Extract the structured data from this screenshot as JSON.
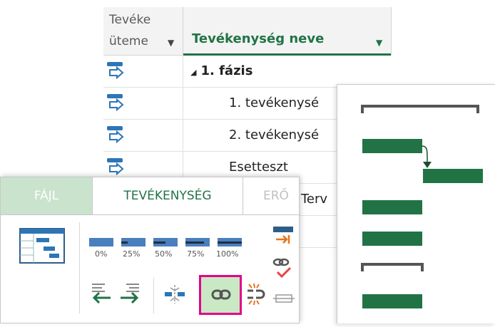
{
  "table": {
    "col_mode_line1": "Tevéke",
    "col_mode_line2": "üteme",
    "col_name": "Tevékenység neve",
    "rows": [
      {
        "name": "1. fázis"
      },
      {
        "name": "1. tevékenysé"
      },
      {
        "name": "2. tevékenysé"
      },
      {
        "name": "Esetteszt"
      },
      {
        "name": "Terv"
      }
    ]
  },
  "ribbon": {
    "tabs": [
      {
        "label": "FÁJL"
      },
      {
        "label": "TEVÉKENYSÉG"
      },
      {
        "label": "ERŐ"
      }
    ],
    "progress": [
      "0%",
      "25%",
      "50%",
      "75%",
      "100%"
    ]
  },
  "colors": {
    "accent": "#217346",
    "bar": "#217346",
    "tab_file": "#c9e3cc",
    "highlight": "#e3008c",
    "link_bg": "#c9e8c4"
  },
  "icons": [
    "task-mode-icon",
    "gantt-chart-icon",
    "outdent-icon",
    "indent-icon",
    "split-task-icon",
    "link-tasks-icon",
    "unlink-tasks-icon",
    "move-task-icon",
    "mark-on-track-icon"
  ]
}
